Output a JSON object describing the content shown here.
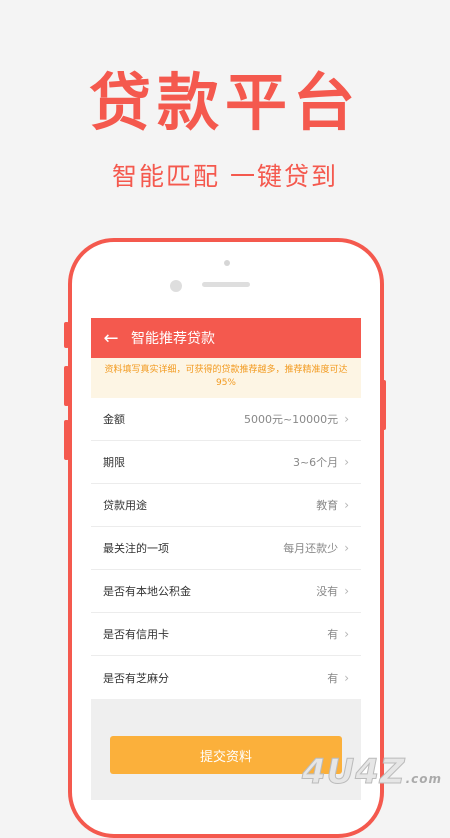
{
  "hero": {
    "title": "贷款平台",
    "subtitle": "智能匹配 一键贷到"
  },
  "header": {
    "back_icon": "back-arrow-icon",
    "title": "智能推荐贷款"
  },
  "notice": "资料填写真实详细，可获得的贷款推荐越多，推荐精准度可达95%",
  "rows": [
    {
      "label": "金额",
      "value": "5000元~10000元"
    },
    {
      "label": "期限",
      "value": "3~6个月"
    },
    {
      "label": "贷款用途",
      "value": "教育"
    },
    {
      "label": "最关注的一项",
      "value": "每月还款少"
    },
    {
      "label": "是否有本地公积金",
      "value": "没有"
    },
    {
      "label": "是否有信用卡",
      "value": "有"
    },
    {
      "label": "是否有芝麻分",
      "value": "有"
    }
  ],
  "submit_label": "提交资料",
  "watermark": {
    "main": "4U4Z",
    "suffix": ".com"
  },
  "colors": {
    "brand": "#f4594e",
    "button": "#fbb03b",
    "notice_text": "#f29b22"
  }
}
